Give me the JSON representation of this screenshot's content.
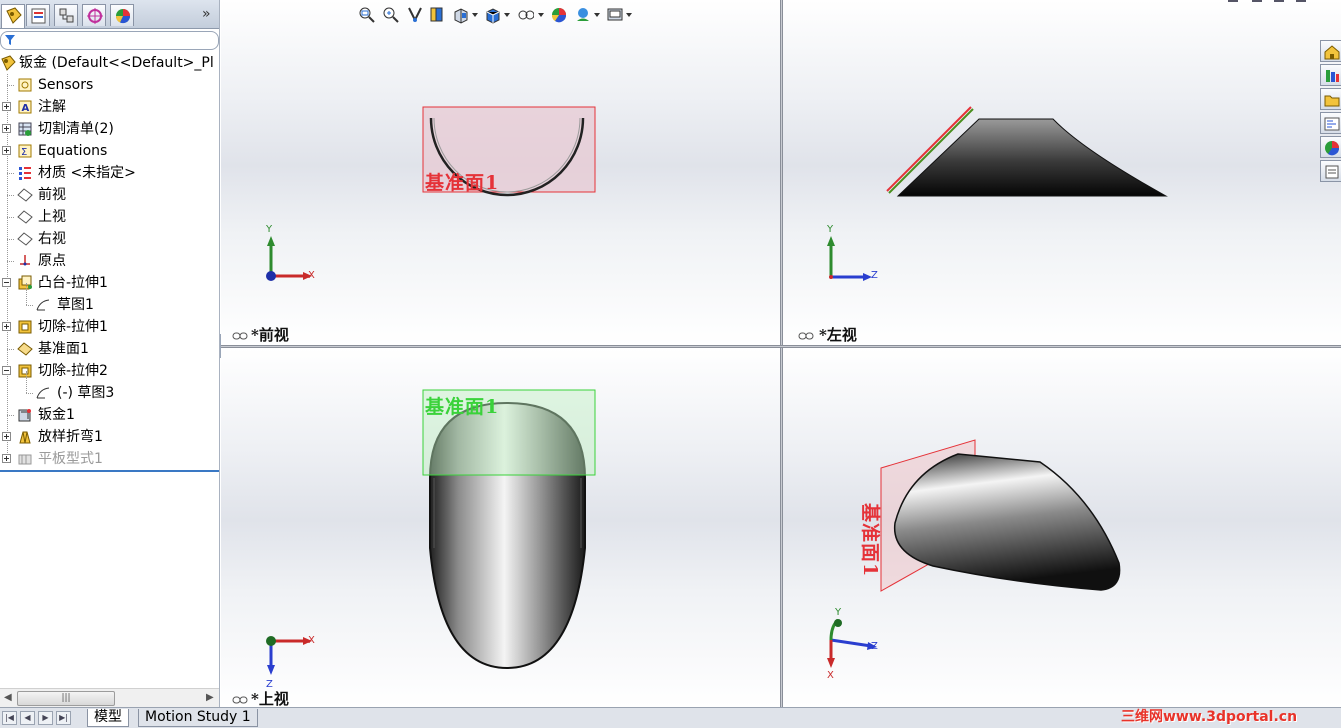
{
  "feature_manager": {
    "more_glyph": "»",
    "tree": [
      {
        "label": "钣金  (Default<<Default>_Pl",
        "icon": "part-icon",
        "depth": 0,
        "expander": "none"
      },
      {
        "label": "Sensors",
        "icon": "sensors-icon",
        "depth": 1,
        "expander": "none"
      },
      {
        "label": "注解",
        "icon": "annotations-icon",
        "depth": 1,
        "expander": "plus"
      },
      {
        "label": "切割清单(2)",
        "icon": "cut-list-icon",
        "depth": 1,
        "expander": "plus"
      },
      {
        "label": "Equations",
        "icon": "equations-icon",
        "depth": 1,
        "expander": "plus"
      },
      {
        "label": "材质 <未指定>",
        "icon": "material-icon",
        "depth": 1,
        "expander": "none"
      },
      {
        "label": "前视",
        "icon": "plane-icon",
        "depth": 1,
        "expander": "none"
      },
      {
        "label": "上视",
        "icon": "plane-icon",
        "depth": 1,
        "expander": "none"
      },
      {
        "label": "右视",
        "icon": "plane-icon",
        "depth": 1,
        "expander": "none"
      },
      {
        "label": "原点",
        "icon": "origin-icon",
        "depth": 1,
        "expander": "none"
      },
      {
        "label": "凸台-拉伸1",
        "icon": "boss-extrude-icon",
        "depth": 1,
        "expander": "minus"
      },
      {
        "label": "草图1",
        "icon": "sketch-icon",
        "depth": 2,
        "expander": "none"
      },
      {
        "label": "切除-拉伸1",
        "icon": "cut-extrude-icon",
        "depth": 1,
        "expander": "plus"
      },
      {
        "label": "基准面1",
        "icon": "ref-plane-icon",
        "depth": 1,
        "expander": "none"
      },
      {
        "label": "切除-拉伸2",
        "icon": "cut-extrude-icon",
        "depth": 1,
        "expander": "minus"
      },
      {
        "label": "(-) 草图3",
        "icon": "sketch-icon",
        "depth": 2,
        "expander": "none"
      },
      {
        "label": "钣金1",
        "icon": "sheet-metal-icon",
        "depth": 1,
        "expander": "none"
      },
      {
        "label": "放样折弯1",
        "icon": "lofted-bend-icon",
        "depth": 1,
        "expander": "plus"
      },
      {
        "label": "平板型式1",
        "icon": "flat-pattern-icon",
        "depth": 1,
        "expander": "plus",
        "suppressed": true
      }
    ],
    "scroll_thumb_glyph": "|||"
  },
  "viewports": {
    "front": {
      "label": "*前视",
      "plane_label": "基准面1",
      "axes": {
        "v": "Y",
        "h": "X"
      }
    },
    "left": {
      "label": "*左视",
      "axes": {
        "v": "Y",
        "h": "Z"
      }
    },
    "top": {
      "label": "*上视",
      "plane_label": "基准面1",
      "axes": {
        "v": "Z",
        "h": "X"
      }
    },
    "iso": {
      "plane_label": "基准面1",
      "axes": {
        "v": "Y",
        "h": "Z",
        "d": "X"
      }
    }
  },
  "colors": {
    "plane_red": "#e53238",
    "plane_green": "#3ad23a",
    "axis_x": "#c92a2a",
    "axis_y": "#2e8b2e",
    "axis_z": "#2a3ecf"
  },
  "bottom_tabs": {
    "model": "模型",
    "motion": "Motion Study 1"
  },
  "watermark": "三维网www.3dportal.cn"
}
